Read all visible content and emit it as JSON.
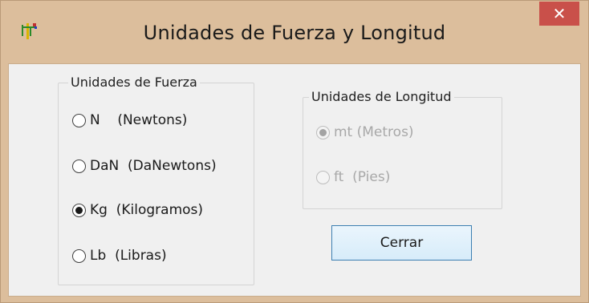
{
  "window": {
    "title": "Unidades de Fuerza y Longitud",
    "close_glyph": "✕",
    "icon": "app-icon"
  },
  "force_group": {
    "title": "Unidades de Fuerza",
    "options": [
      {
        "label": "N    (Newtons)",
        "selected": false
      },
      {
        "label": "DaN  (DaNewtons)",
        "selected": false
      },
      {
        "label": "Kg  (Kilogramos)",
        "selected": true
      },
      {
        "label": "Lb  (Libras)",
        "selected": false
      }
    ]
  },
  "length_group": {
    "title": "Unidades de Longitud",
    "enabled": false,
    "options": [
      {
        "label": "mt (Metros)",
        "selected": true
      },
      {
        "label": "ft  (Pies)",
        "selected": false
      }
    ]
  },
  "buttons": {
    "close_label": "Cerrar"
  },
  "colors": {
    "frame": "#dcbe9c",
    "close": "#c9504a",
    "client": "#f0f0f0"
  }
}
